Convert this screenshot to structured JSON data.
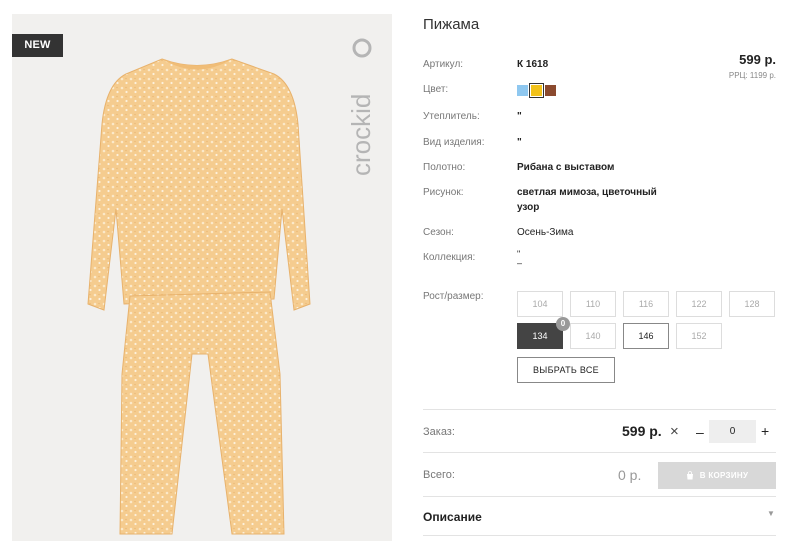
{
  "product": {
    "title": "Пижама",
    "badge": "NEW",
    "brand": "crockid",
    "price": "599 р.",
    "rrp": "РРЦ: 1199 р."
  },
  "details": {
    "article_label": "Артикул:",
    "article_value": "К 1618",
    "color_label": "Цвет:",
    "colors": [
      {
        "name": "light blue",
        "hex": "#8fc8f0"
      },
      {
        "name": "yellow",
        "hex": "#f2c21a"
      },
      {
        "name": "brown",
        "hex": "#8b4a2f"
      }
    ],
    "insulation_label": "Утеплитель:",
    "insulation_value": "\"",
    "type_label": "Вид изделия:",
    "type_value": "\"",
    "fabric_label": "Полотно:",
    "fabric_value": "Рибана с выставом",
    "pattern_label": "Рисунок:",
    "pattern_value": "светлая мимоза, цветочный узор",
    "season_label": "Сезон:",
    "season_value": "Осень-Зима",
    "collection_label": "Коллекция:",
    "collection_value": "\"\n–"
  },
  "sizes": {
    "label": "Рост/размер:",
    "row1": [
      "104",
      "110",
      "116",
      "122",
      "128"
    ],
    "row2": [
      "134",
      "140",
      "146",
      "152"
    ],
    "selected_count": "0",
    "select_all": "ВЫБРАТЬ ВСЕ"
  },
  "order": {
    "label": "Заказ:",
    "price": "599 р.",
    "times": "×",
    "minus": "–",
    "plus": "+",
    "qty": "0"
  },
  "total": {
    "label": "Всего:",
    "value": "0 р.",
    "cart_button": "В КОРЗИНУ"
  },
  "description": {
    "label": "Описание"
  }
}
